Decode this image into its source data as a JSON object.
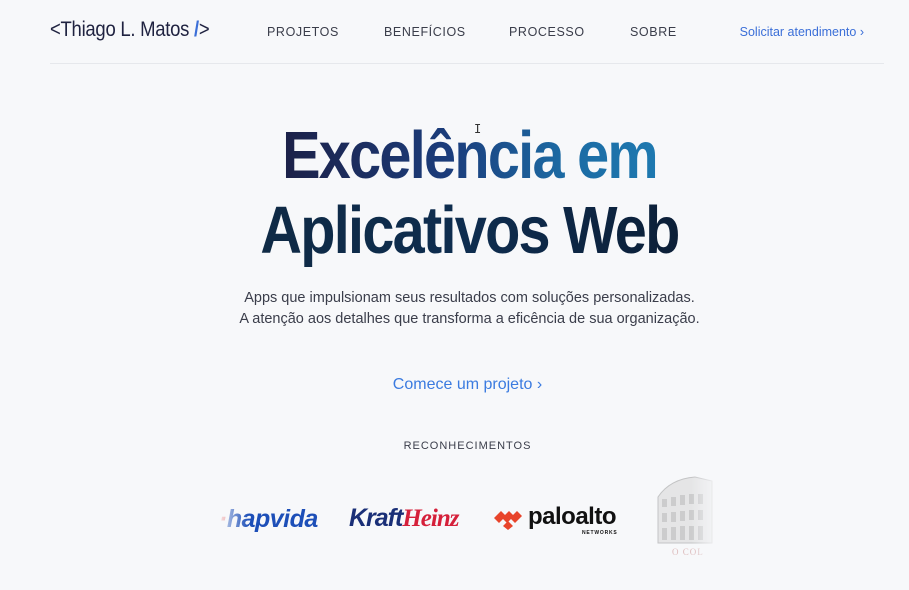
{
  "header": {
    "logo_open": "<",
    "logo_name": "Thiago L. Matos",
    "logo_close_slash": "/",
    "logo_close": ">",
    "menu": [
      {
        "label": "PROJETOS"
      },
      {
        "label": "BENEFÍCIOS"
      },
      {
        "label": "PROCESSO"
      },
      {
        "label": "SOBRE"
      }
    ],
    "cta_label": "Solicitar atendimento ›"
  },
  "hero": {
    "title_line1": "Excelência em",
    "title_line2": "Aplicativos Web",
    "subtitle_line1": "Apps que impulsionam seus resultados com soluções personalizadas.",
    "subtitle_line2": "A atenção aos detalhes que transforma a eficência de sua organização.",
    "start_label": "Comece um projeto ›"
  },
  "recognition": {
    "heading": "RECONHECIMENTOS",
    "logos": [
      {
        "name": "hapvida-logo",
        "text_a": "·",
        "text_b": "hapvida"
      },
      {
        "name": "kraft-heinz-logo",
        "text_a": "Kraft",
        "text_b": "Heinz"
      },
      {
        "name": "palo-alto-logo",
        "text_a": "paloalto",
        "text_b": "NETWORKS"
      },
      {
        "name": "coliseum-logo",
        "text_a": "O COL"
      }
    ]
  },
  "colors": {
    "background": "#f7f8fa",
    "accent": "#3b7be0",
    "title_dark": "#1c2148",
    "title_blue": "#1e79b0"
  }
}
